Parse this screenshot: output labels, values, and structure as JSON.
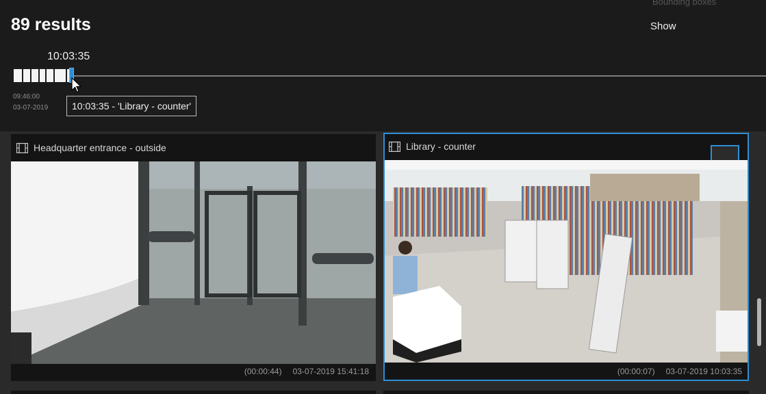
{
  "header": {
    "results": "89 results",
    "bounding_boxes_label": "Bounding boxes",
    "show_label": "Show"
  },
  "timeline": {
    "current_time": "10:03:35",
    "start_time": "09:46:00",
    "start_date": "03-07-2019",
    "tooltip": "10:03:35 - 'Library - counter'"
  },
  "tiles": [
    {
      "name": "Headquarter entrance - outside",
      "duration": "(00:00:44)",
      "timestamp": "03-07-2019  15:41:18",
      "selected": false
    },
    {
      "name": "Library - counter",
      "duration": "(00:00:07)",
      "timestamp": "03-07-2019  10:03:35",
      "selected": true
    }
  ],
  "colors": {
    "accent": "#2d8fd6",
    "background": "#1b1b1b"
  }
}
